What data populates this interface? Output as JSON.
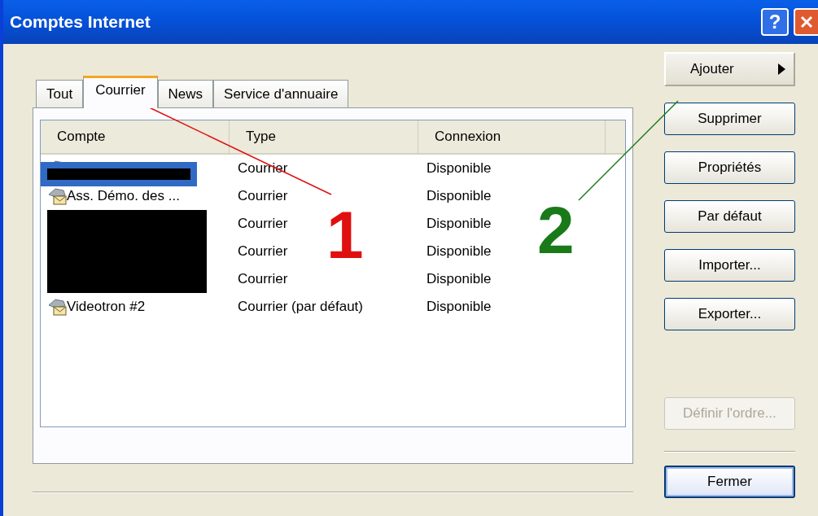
{
  "window": {
    "title": "Comptes Internet",
    "help_button": "?"
  },
  "tabs": [
    {
      "label": "Tout",
      "selected": false
    },
    {
      "label": "Courrier",
      "selected": true
    },
    {
      "label": "News",
      "selected": false
    },
    {
      "label": "Service d'annuaire",
      "selected": false
    }
  ],
  "table": {
    "columns": [
      "Compte",
      "Type",
      "Connexion"
    ],
    "rows": [
      {
        "account": "",
        "redacted": true,
        "icon_hidden": false,
        "selected": true,
        "type": "Courrier",
        "connection": "Disponible"
      },
      {
        "account": "Ass. Démo. des ...",
        "redacted": false,
        "icon_hidden": false,
        "selected": false,
        "type": "Courrier",
        "connection": "Disponible"
      },
      {
        "account": "",
        "redacted": true,
        "icon_hidden": true,
        "selected": false,
        "type": "Courrier",
        "connection": "Disponible"
      },
      {
        "account": "",
        "redacted": true,
        "icon_hidden": true,
        "selected": false,
        "type": "Courrier",
        "connection": "Disponible"
      },
      {
        "account": "",
        "redacted": true,
        "icon_hidden": true,
        "selected": false,
        "type": "Courrier",
        "connection": "Disponible"
      },
      {
        "account": "Videotron #2",
        "redacted": false,
        "icon_hidden": false,
        "selected": false,
        "type": "Courrier (par défaut)",
        "connection": "Disponible"
      }
    ]
  },
  "buttons": [
    {
      "label": "Ajouter",
      "kind": "menu",
      "disabled": false
    },
    {
      "label": "Supprimer",
      "kind": "push",
      "disabled": false
    },
    {
      "label": "Propriétés",
      "kind": "push",
      "disabled": false
    },
    {
      "label": "Par défaut",
      "kind": "push",
      "disabled": false
    },
    {
      "label": "Importer...",
      "kind": "push",
      "disabled": false
    },
    {
      "label": "Exporter...",
      "kind": "push",
      "disabled": false
    },
    {
      "label": "Définir l'ordre...",
      "kind": "push",
      "disabled": true
    }
  ],
  "close_button": "Fermer",
  "annotations": [
    {
      "label": "1",
      "color": "#e01010"
    },
    {
      "label": "2",
      "color": "#1a7a1a"
    }
  ]
}
